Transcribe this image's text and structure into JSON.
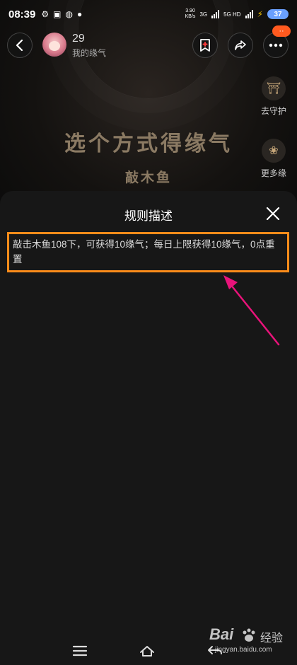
{
  "status_bar": {
    "time": "08:39",
    "net_speed": "3.90",
    "net_unit": "KB/s",
    "sim1": "3G",
    "sim2": "5G HD",
    "battery": "37"
  },
  "header": {
    "score": "29",
    "score_label": "我的缘气",
    "badge": "··"
  },
  "side": {
    "guard_label": "去守护",
    "more_label": "更多缘"
  },
  "main": {
    "title": "选个方式得缘气",
    "subtitle": "敲木鱼"
  },
  "sheet": {
    "title": "规则描述",
    "rule_text": "敲击木鱼108下，可获得10缘气；每日上限获得10缘气，0点重置"
  },
  "watermark": {
    "brand": "Bai",
    "brand_cn": "经验",
    "url": "jingyan.baidu.com"
  },
  "colors": {
    "highlight_border": "#ff8c1a",
    "arrow": "#e8137a",
    "title_gold": "#8b7a63",
    "badge": "#ff5a1f"
  }
}
